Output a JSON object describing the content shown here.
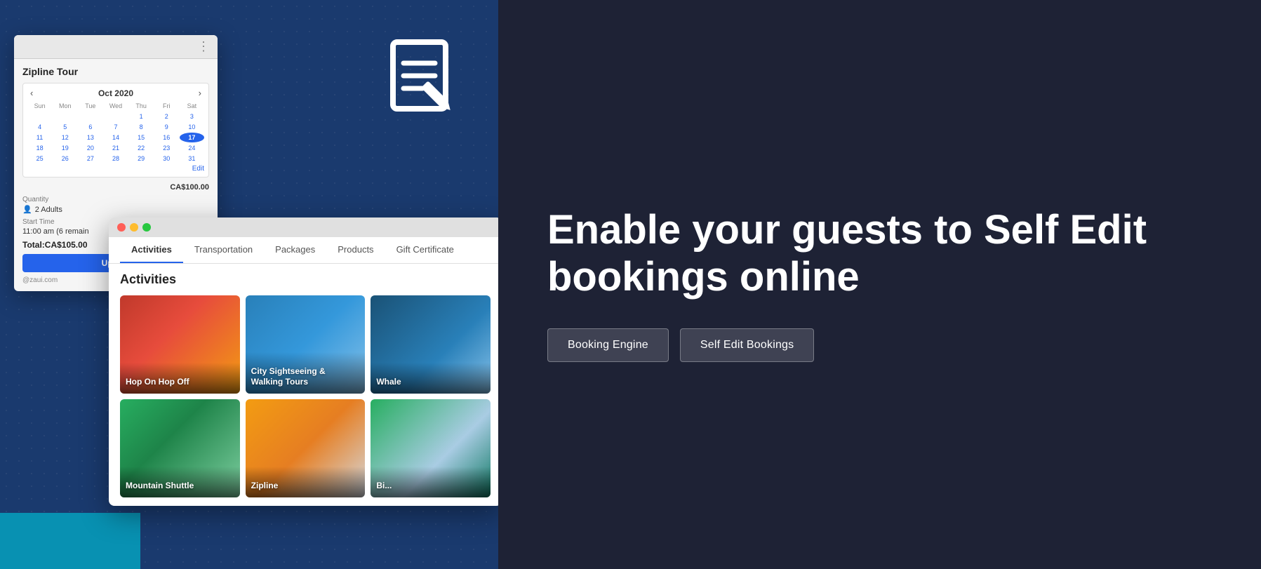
{
  "left": {
    "widget": {
      "tour_title": "Zipline Tour",
      "calendar": {
        "month": "Oct 2020",
        "days_header": [
          "Sun",
          "Mon",
          "Tue",
          "Wed",
          "Thu",
          "Fri",
          "Sat"
        ],
        "days": [
          "",
          "",
          "",
          "",
          "1",
          "2",
          "3",
          "4",
          "5",
          "6",
          "7",
          "8",
          "9",
          "10",
          "11",
          "12",
          "13",
          "14",
          "15",
          "16",
          "17",
          "18",
          "19",
          "20",
          "21",
          "22",
          "23",
          "24",
          "25",
          "26",
          "27",
          "28",
          "29",
          "30",
          "31"
        ],
        "selected_day": "17",
        "edit_label": "Edit"
      },
      "price": "CA$100.00",
      "quantity_label": "Quantity",
      "quantity_value": "2 Adults",
      "start_time_label": "Start Time",
      "start_time_value": "11:00 am (6 remain",
      "total_label": "Total:",
      "total_value": "CA$105.00",
      "update_button": "Update",
      "email": "@zaui.com"
    },
    "popup": {
      "tabs": [
        "Activities",
        "Transportation",
        "Packages",
        "Products",
        "Gift Certificate"
      ],
      "active_tab": "Activities",
      "section_title": "Activities",
      "activities": [
        {
          "name": "Hop On Hop Off",
          "style": "act-hop"
        },
        {
          "name": "City Sightseeing & Walking Tours",
          "style": "act-city"
        },
        {
          "name": "Whale",
          "style": "act-whale"
        },
        {
          "name": "Mountain Shuttle",
          "style": "act-mountain"
        },
        {
          "name": "Zipline",
          "style": "act-zipline"
        },
        {
          "name": "Bi...",
          "style": "act-bike"
        }
      ]
    }
  },
  "right": {
    "hero_title": "Enable your guests to Self Edit bookings online",
    "buttons": [
      {
        "label": "Booking Engine"
      },
      {
        "label": "Self Edit Bookings"
      }
    ]
  }
}
